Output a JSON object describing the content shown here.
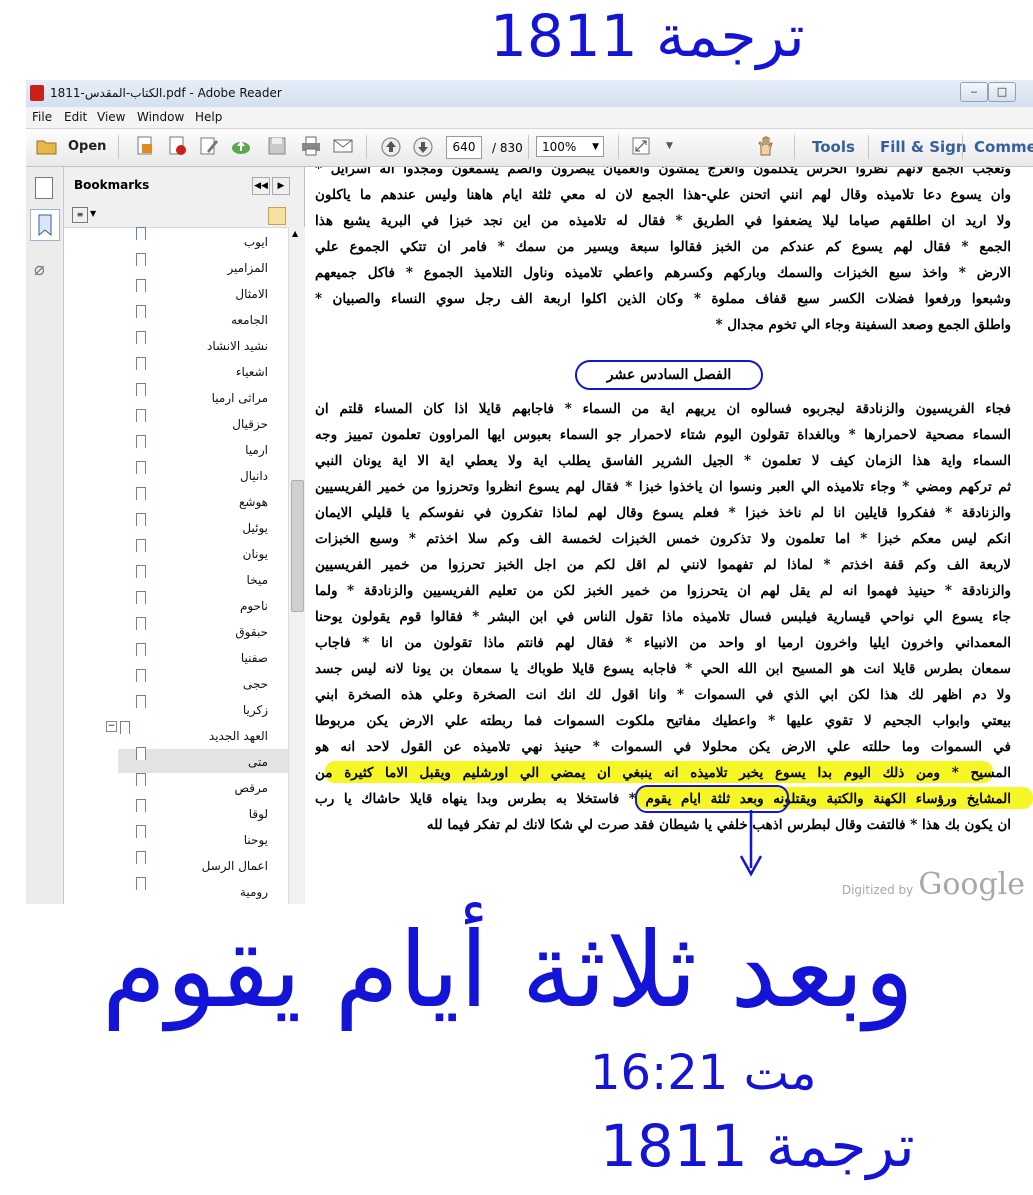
{
  "window": {
    "title": "1811-الكتاب-المقدس.pdf - Adobe Reader",
    "minimize": "‒",
    "maximize": "□"
  },
  "menu": [
    "File",
    "Edit",
    "View",
    "Window",
    "Help"
  ],
  "toolbar": {
    "open_label": "Open",
    "page_current": "640",
    "page_total": "/ 830",
    "zoom": "100%",
    "tools_label": "Tools",
    "fill_sign_label": "Fill & Sign",
    "comment_label": "Comme"
  },
  "bookmarks": {
    "title": "Bookmarks",
    "items": [
      {
        "label": "ايوب"
      },
      {
        "label": "المزامير"
      },
      {
        "label": "الامثال"
      },
      {
        "label": "الجامعه"
      },
      {
        "label": "نشيد الانشاد"
      },
      {
        "label": "اشعياء"
      },
      {
        "label": "مراثى ارميا"
      },
      {
        "label": "حزقيال"
      },
      {
        "label": "ارميا"
      },
      {
        "label": "دانيال"
      },
      {
        "label": "هوشع"
      },
      {
        "label": "يوئيل"
      },
      {
        "label": "يونان"
      },
      {
        "label": "ميخا"
      },
      {
        "label": "ناحوم"
      },
      {
        "label": "حبقوق"
      },
      {
        "label": "صفنيا"
      },
      {
        "label": "حجى"
      },
      {
        "label": "زكريا"
      },
      {
        "label": "العهد الجديد",
        "expanded": true
      },
      {
        "label": "متى",
        "selected": true
      },
      {
        "label": "مرقص"
      },
      {
        "label": "لوقا"
      },
      {
        "label": "يوحنا"
      },
      {
        "label": "اعمال الرسل"
      },
      {
        "label": "رومية"
      }
    ]
  },
  "document": {
    "top_lines": [
      "وتعجب الجمع لانهم نظروا الخرس يتكلمون والعرج يمشون والعميان يبصرون والصم يسمعون ومجدوا اله اسرايل *",
      "وان يسوع دعا تلاميذه وقال لهم انني اتحنن علي-هذا الجمع لان له معي ثلثة ايام هاهنا وليس عندهم ما ياكلون",
      "ولا اريد ان اطلقهم صياما ليلا يضعفوا في الطريق * فقال له تلاميذه من اين نجد خبزا في البرية يشبع هذا",
      "الجمع * فقال لهم يسوع كم عندكم من الخبز فقالوا سبعة ويسير من سمك * فامر ان تتكي الجموع علي",
      "الارض * واخذ سبع الخبزات والسمك وباركهم وكسرهم واعطي تلاميذه وناول التلاميذ الجموع * فاكل جميعهم",
      "وشبعوا ورفعوا فضلات الكسر سبع قفاف مملوة * وكان الذين اكلوا اربعة الف رجل سوي النساء والصبيان *",
      "واطلق الجمع وصعد السفينة وجاء الي تخوم مجدال *"
    ],
    "chapter_heading": "الفصل السادس عشر",
    "chapter_lines": [
      "فجاء الفريسيون والزنادقة ليجربوه فسالوه ان يريهم اية من السماء * فاجابهم قايلا اذا كان المساء قلتم ان",
      "السماء مصحية لاحمرارها * وبالغداة تقولون اليوم شتاء لاحمرار جو السماء بعبوس ايها المراوون تعلمون تمييز وجه",
      "السماء واية هذا الزمان كيف لا تعلمون * الجيل الشرير الفاسق يطلب اية ولا يعطي اية الا اية يونان النبي",
      "ثم تركهم ومضي * وجاء تلاميذه الي العبر ونسوا ان ياخذوا خبزا * فقال لهم يسوع انظروا وتحرزوا من خمير الفريسيين",
      "والزنادقة * ففكروا قايلين انا لم ناخذ خبزا * فعلم يسوع وقال لهم لماذا تفكرون في نفوسكم يا قليلي الايمان",
      "انكم ليس معكم خبزا * اما تعلمون ولا تذكرون خمس الخبزات لخمسة الف وكم سلا اخذتم * وسبع الخبزات",
      "لاربعة الف وكم قفة اخذتم * لماذا لم تفهموا لانني لم اقل لكم من اجل الخبز تحرزوا من خمير الفريسيين",
      "والزنادقة * حينيذ فهموا انه لم يقل لهم ان يتحرزوا من خمير الخبز لكن من تعليم الفريسيين والزنادقة * ولما",
      "جاء يسوع الي نواحي قيسارية فيلبس فسال تلاميذه ماذا تقول الناس في ابن البشر * فقالوا قوم يقولون يوحنا",
      "المعمداني واخرون ايليا واخرون ارميا او واحد من الانبياء * فقال لهم فانتم ماذا تقولون من انا * فاجاب",
      "سمعان بطرس قايلا انت هو المسيح ابن الله الحي * فاجابه يسوع قايلا طوباك يا سمعان بن يونا لانه ليس جسد",
      "ولا دم اظهر لك هذا لكن ابي الذي في السموات * وانا اقول لك انك انت الصخرة وعلي هذه الصخرة ابني",
      "بيعتي وابواب الجحيم لا تقوي عليها * واعطيك مفاتيح ملكوت السموات فما ربطته علي الارض يكن مربوطا",
      "في السموات وما حللته علي الارض يكن محلولا في السموات * حينيذ نهي تلاميذه عن القول لاحد انه هو",
      "المسيح * ومن ذلك اليوم بدا يسوع يخبر تلاميذه انه ينبغي ان يمضي الي اورشليم ويقبل الاما كثيرة من",
      "المشايخ ورؤساء الكهنة والكتبة ويقتلونه وبعد ثلثة ايام يقوم * فاستخلا به بطرس وبدا ينهاه قايلا حاشاك يا رب",
      "ان يكون بك هذا * فالتفت وقال لبطرس اذهب خلفي يا شيطان فقد صرت لي شكا لانك لم تفكر فيما لله"
    ],
    "watermark_prefix": "Digitized by",
    "watermark_brand": "Google"
  },
  "handwriting": {
    "top_note": "ترجمة 1811",
    "big_note": "وبعد ثلاثة أيام يقوم",
    "reference": "مت 16:21",
    "bottom_note": "ترجمة 1811"
  },
  "colors": {
    "ink": "#1414d6",
    "highlight": "#f5f500",
    "pdf_red": "#c8201a",
    "tab_blue": "#36609b"
  }
}
